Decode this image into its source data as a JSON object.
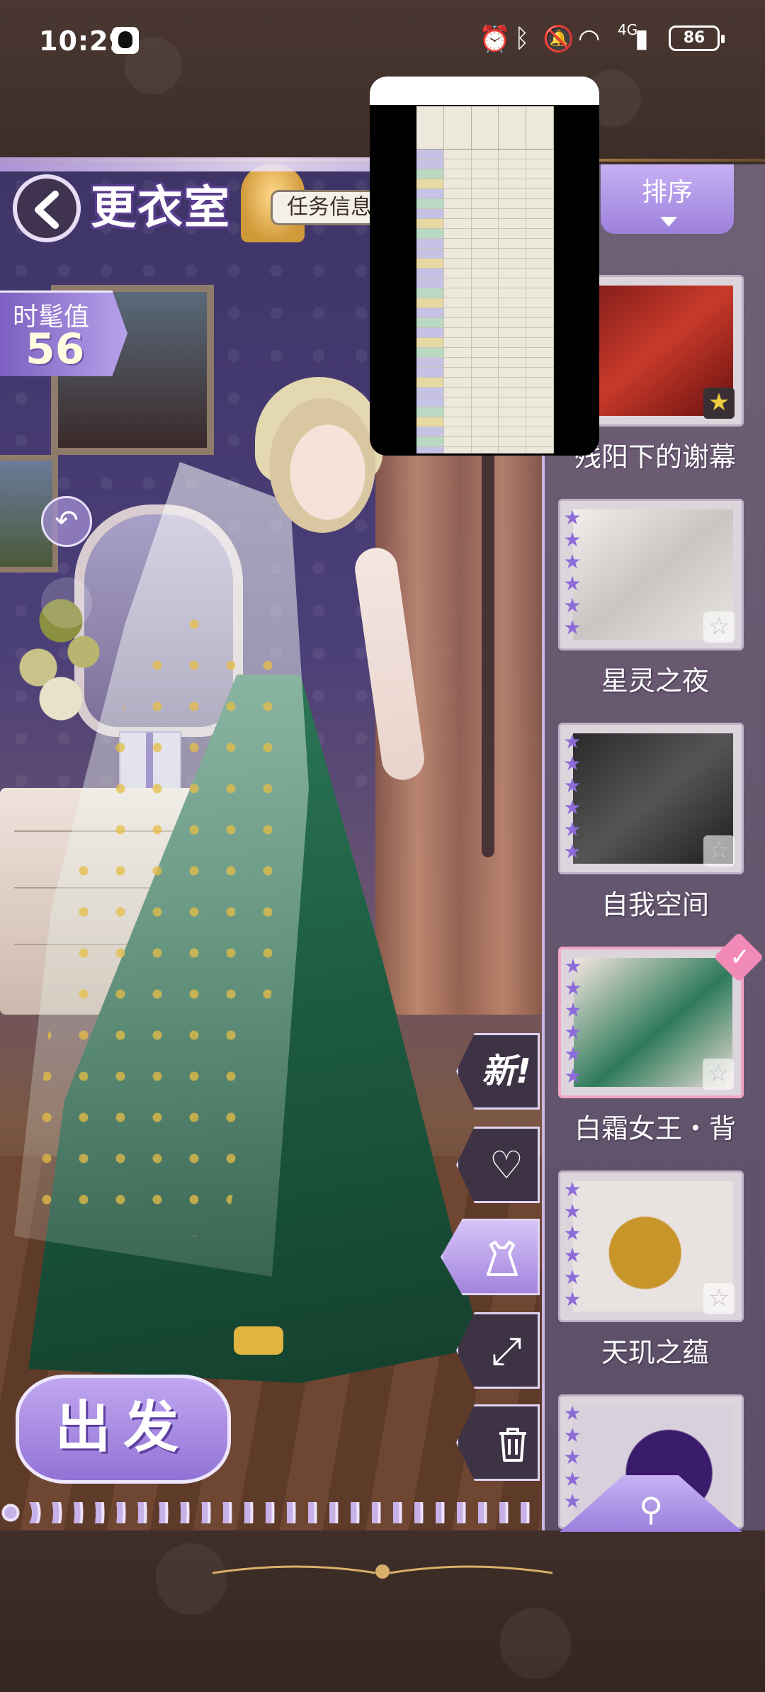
{
  "status_bar": {
    "time": "10:29",
    "network": "4G",
    "battery": "86"
  },
  "header": {
    "title": "更衣室",
    "task_button": "任务信息"
  },
  "fashion": {
    "label": "时髦值",
    "value": "56"
  },
  "go_button": "出发",
  "side_actions": {
    "new_label": "新!",
    "favorite_icon": "heart-icon",
    "dress_icon": "dress-icon",
    "fullscreen_icon": "expand-icon",
    "delete_icon": "trash-icon"
  },
  "panel": {
    "sort_label": "排序",
    "items": [
      {
        "name": "残阳下的谢幕",
        "favorited": true,
        "selected": false
      },
      {
        "name": "星灵之夜",
        "favorited": false,
        "selected": false
      },
      {
        "name": "自我空间",
        "favorited": false,
        "selected": false
      },
      {
        "name": "白霜女王・背",
        "favorited": false,
        "selected": true
      },
      {
        "name": "天玑之蕴",
        "favorited": false,
        "selected": false
      },
      {
        "name": "",
        "favorited": false,
        "selected": false
      }
    ],
    "search_icon": "search-icon"
  },
  "colors": {
    "accent_purple": "#9d80dc",
    "frame_brown": "#3d2d28",
    "selected_pink": "#f28ab8"
  }
}
